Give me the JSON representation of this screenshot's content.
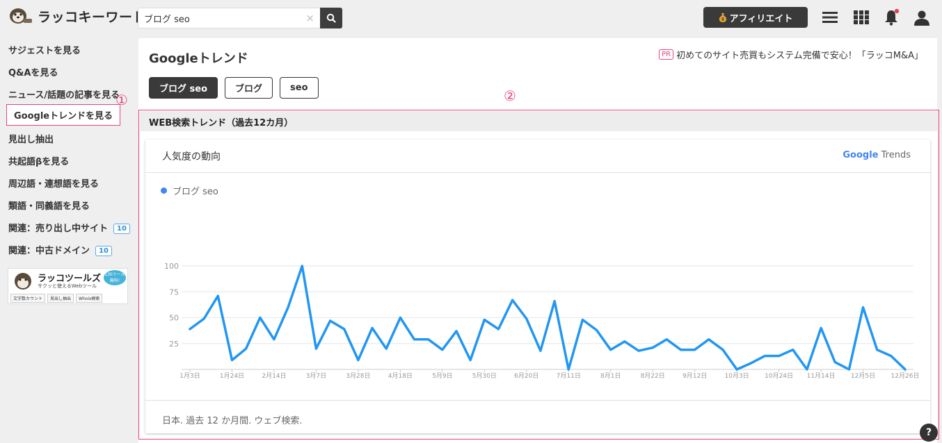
{
  "header": {
    "logo_text": "ラッコキーワード",
    "search_value": "ブログ seo",
    "clear_glyph": "×",
    "affiliate_label": "アフィリエイト",
    "affiliate_icon": "money-bag-icon"
  },
  "sidebar": {
    "items": [
      {
        "label": "サジェストを見る"
      },
      {
        "label": "Q&Aを見る"
      },
      {
        "label": "ニュース/話題の記事を見る"
      },
      {
        "label": "Googleトレンドを見る"
      },
      {
        "label": "見出し抽出"
      },
      {
        "label": "共起語βを見る"
      },
      {
        "label": "周辺語・連想語を見る"
      },
      {
        "label": "類語・同義語を見る"
      },
      {
        "label": "関連：売り出し中サイト",
        "badge": "10"
      },
      {
        "label": "関連：中古ドメイン",
        "badge": "10"
      }
    ],
    "annotation_1": "①",
    "tools_banner": {
      "title": "ラッコツールズ",
      "subtitle": "サクッと使えるWebツール",
      "badge": "130ツール 無料!",
      "buttons": [
        "文字数カウント",
        "見出し抽出",
        "Whois検索"
      ]
    }
  },
  "main": {
    "title": "Googleトレンド",
    "pr_tag": "PR",
    "pr_text": "初めてのサイト売買もシステム完備で安心！「ラッコM&A」",
    "keyword_tabs": [
      "ブログ seo",
      "ブログ",
      "seo"
    ],
    "annotation_2": "②",
    "section_title": "WEB検索トレンド（過去12カ月）",
    "card_title": "人気度の動向",
    "google_logo": "Google",
    "trends_word": "Trends",
    "legend_label": "ブログ seo",
    "footer": "日本. 過去 12 か月間. ウェブ検索."
  },
  "colors": {
    "accent_pink": "#e8437a",
    "line_blue": "#2196f3",
    "dark": "#3a3a3a"
  },
  "chart_data": {
    "type": "line",
    "ylim": [
      0,
      100
    ],
    "y_ticks": [
      25,
      50,
      75,
      100
    ],
    "x_tick_labels": [
      "1月3日",
      "1月24日",
      "2月14日",
      "3月7日",
      "3月28日",
      "4月18日",
      "5月9日",
      "5月30日",
      "6月20日",
      "7月11日",
      "8月1日",
      "8月22日",
      "9月12日",
      "10月3日",
      "10月24日",
      "11月14日",
      "12月5日",
      "12月26日"
    ],
    "series": [
      {
        "name": "ブログ seo",
        "values": [
          39,
          49,
          71,
          9,
          20,
          50,
          29,
          60,
          100,
          20,
          47,
          39,
          9,
          40,
          20,
          50,
          29,
          29,
          19,
          37,
          9,
          48,
          39,
          67,
          49,
          18,
          66,
          0,
          48,
          38,
          19,
          27,
          18,
          21,
          29,
          19,
          19,
          29,
          19,
          0,
          6,
          13,
          13,
          19,
          0,
          40,
          7,
          0,
          60,
          19,
          13,
          0
        ]
      }
    ]
  },
  "help_glyph": "?"
}
